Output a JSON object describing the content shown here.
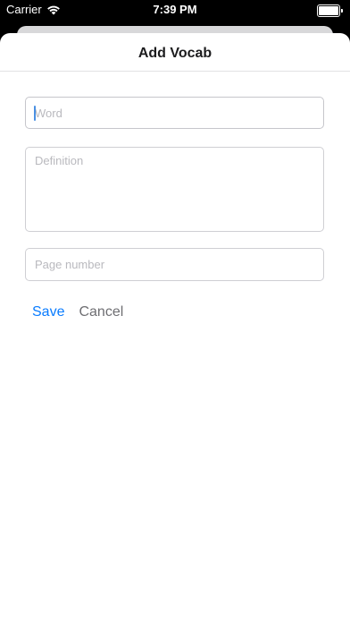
{
  "status_bar": {
    "carrier": "Carrier",
    "time": "7:39 PM",
    "battery_level": 1.0,
    "icons": [
      "wifi-icon",
      "battery-icon"
    ]
  },
  "sheet": {
    "title": "Add Vocab"
  },
  "form": {
    "word": {
      "value": "",
      "placeholder": "Word"
    },
    "definition": {
      "value": "",
      "placeholder": "Definition"
    },
    "page_number": {
      "value": "",
      "placeholder": "Page number"
    }
  },
  "actions": {
    "save_label": "Save",
    "cancel_label": "Cancel"
  },
  "colors": {
    "accent": "#0a7cff",
    "cancel": "#6e6e72",
    "background": "#ffffff",
    "status_bar_background": "#000000"
  }
}
